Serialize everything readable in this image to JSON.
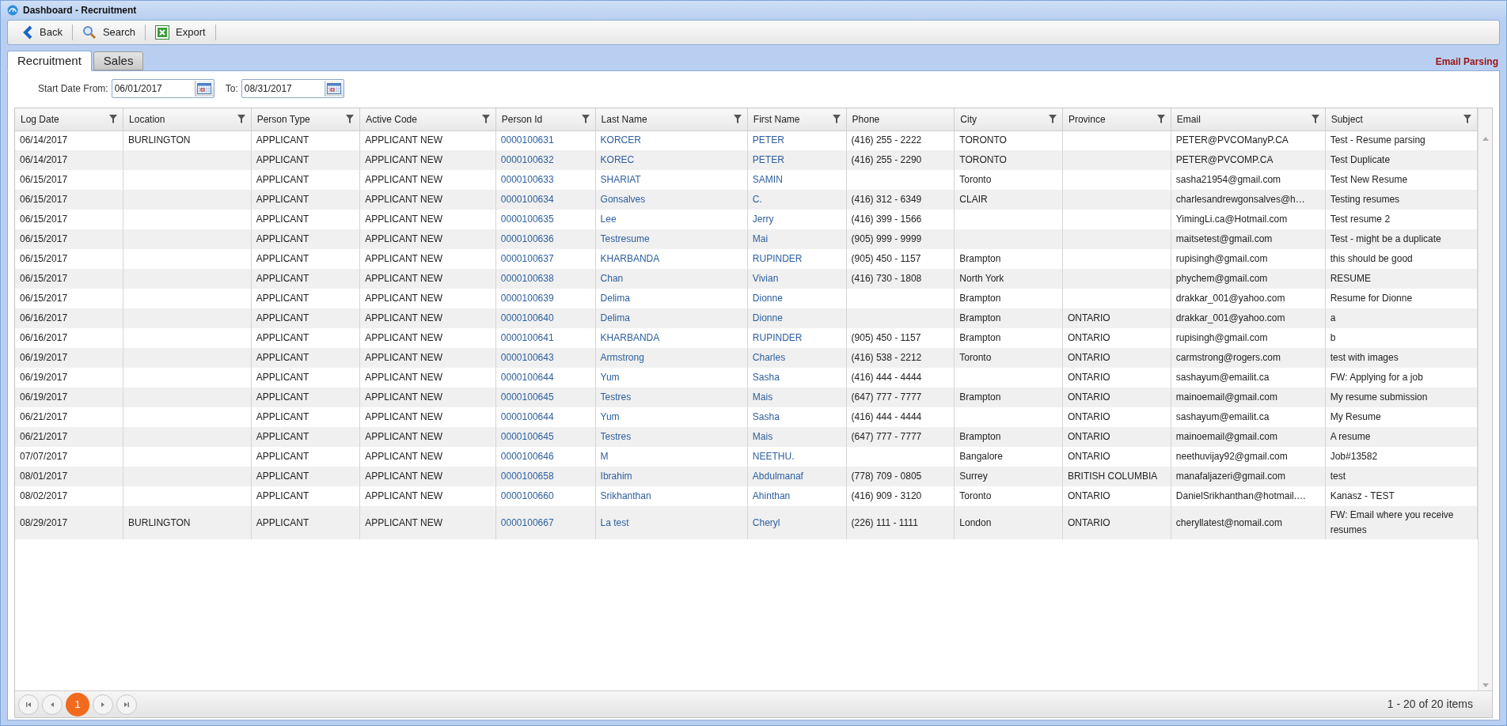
{
  "window": {
    "title": "Dashboard - Recruitment"
  },
  "toolbar": [
    {
      "kind": "back",
      "label": "Back"
    },
    {
      "kind": "search",
      "label": "Search"
    },
    {
      "kind": "export",
      "label": "Export"
    }
  ],
  "tabs": [
    {
      "label": "Recruitment",
      "selected": true
    },
    {
      "label": "Sales",
      "selected": false
    }
  ],
  "section_title": "Email Parsing",
  "filters": [
    {
      "label": "Start Date From:",
      "value": "06/01/2017"
    },
    {
      "label": "To:",
      "value": "08/31/2017"
    }
  ],
  "table": {
    "columns": [
      {
        "label": "Log Date",
        "filter": true,
        "kind": "text"
      },
      {
        "label": "Location",
        "filter": true,
        "kind": "text"
      },
      {
        "label": "Person Type",
        "filter": true,
        "kind": "text"
      },
      {
        "label": "Active Code",
        "filter": true,
        "kind": "text"
      },
      {
        "label": "Person Id",
        "filter": true,
        "kind": "link"
      },
      {
        "label": "Last Name",
        "filter": true,
        "kind": "link"
      },
      {
        "label": "First Name",
        "filter": true,
        "kind": "link"
      },
      {
        "label": "Phone",
        "filter": false,
        "kind": "text"
      },
      {
        "label": "City",
        "filter": true,
        "kind": "text"
      },
      {
        "label": "Province",
        "filter": true,
        "kind": "text"
      },
      {
        "label": "Email",
        "filter": true,
        "kind": "text"
      },
      {
        "label": "Subject",
        "filter": true,
        "kind": "text"
      }
    ],
    "rows": [
      [
        "06/14/2017",
        "BURLINGTON",
        "APPLICANT",
        "APPLICANT NEW",
        "0000100631",
        "KORCER",
        "PETER",
        "(416) 255 - 2222",
        "TORONTO",
        "",
        "PETER@PVCOManyP.CA",
        "Test - Resume parsing"
      ],
      [
        "06/14/2017",
        "",
        "APPLICANT",
        "APPLICANT NEW",
        "0000100632",
        "KOREC",
        "PETER",
        "(416) 255 - 2290",
        "TORONTO",
        "",
        "PETER@PVCOMP.CA",
        "Test Duplicate"
      ],
      [
        "06/15/2017",
        "",
        "APPLICANT",
        "APPLICANT NEW",
        "0000100633",
        "SHARIAT",
        "SAMIN",
        "",
        "Toronto",
        "",
        "sasha21954@gmail.com",
        "Test New Resume"
      ],
      [
        "06/15/2017",
        "",
        "APPLICANT",
        "APPLICANT NEW",
        "0000100634",
        "Gonsalves",
        "C.",
        "(416) 312 - 6349",
        "CLAIR",
        "",
        "charlesandrewgonsalves@h…",
        "Testing resumes"
      ],
      [
        "06/15/2017",
        "",
        "APPLICANT",
        "APPLICANT NEW",
        "0000100635",
        "Lee",
        "Jerry",
        "(416) 399 - 1566",
        "",
        "",
        "YimingLi.ca@Hotmail.com",
        "Test resume 2"
      ],
      [
        "06/15/2017",
        "",
        "APPLICANT",
        "APPLICANT NEW",
        "0000100636",
        "Testresume",
        "Mai",
        "(905) 999 - 9999",
        "",
        "",
        "maitsetest@gmail.com",
        "Test - might be a duplicate"
      ],
      [
        "06/15/2017",
        "",
        "APPLICANT",
        "APPLICANT NEW",
        "0000100637",
        "KHARBANDA",
        "RUPINDER",
        "(905) 450 - 1157",
        "Brampton",
        "",
        "rupisingh@gmail.com",
        "this should be good"
      ],
      [
        "06/15/2017",
        "",
        "APPLICANT",
        "APPLICANT NEW",
        "0000100638",
        "Chan",
        "Vivian",
        "(416) 730 - 1808",
        "North York",
        "",
        "phychem@gmail.com",
        "RESUME"
      ],
      [
        "06/15/2017",
        "",
        "APPLICANT",
        "APPLICANT NEW",
        "0000100639",
        "Delima",
        "Dionne",
        "",
        "Brampton",
        "",
        "drakkar_001@yahoo.com",
        "Resume for Dionne"
      ],
      [
        "06/16/2017",
        "",
        "APPLICANT",
        "APPLICANT NEW",
        "0000100640",
        "Delima",
        "Dionne",
        "",
        "Brampton",
        "ONTARIO",
        "drakkar_001@yahoo.com",
        "a"
      ],
      [
        "06/16/2017",
        "",
        "APPLICANT",
        "APPLICANT NEW",
        "0000100641",
        "KHARBANDA",
        "RUPINDER",
        "(905) 450 - 1157",
        "Brampton",
        "ONTARIO",
        "rupisingh@gmail.com",
        "b"
      ],
      [
        "06/19/2017",
        "",
        "APPLICANT",
        "APPLICANT NEW",
        "0000100643",
        "Armstrong",
        "Charles",
        "(416) 538 - 2212",
        "Toronto",
        "ONTARIO",
        "carmstrong@rogers.com",
        "test with images"
      ],
      [
        "06/19/2017",
        "",
        "APPLICANT",
        "APPLICANT NEW",
        "0000100644",
        "Yum",
        "Sasha",
        "(416) 444 - 4444",
        "",
        "ONTARIO",
        "sashayum@emailit.ca",
        "FW: Applying for a job"
      ],
      [
        "06/19/2017",
        "",
        "APPLICANT",
        "APPLICANT NEW",
        "0000100645",
        "Testres",
        "Mais",
        "(647) 777 - 7777",
        "Brampton",
        "ONTARIO",
        "mainoemail@gmail.com",
        "My resume submission"
      ],
      [
        "06/21/2017",
        "",
        "APPLICANT",
        "APPLICANT NEW",
        "0000100644",
        "Yum",
        "Sasha",
        "(416) 444 - 4444",
        "",
        "ONTARIO",
        "sashayum@emailit.ca",
        "My Resume"
      ],
      [
        "06/21/2017",
        "",
        "APPLICANT",
        "APPLICANT NEW",
        "0000100645",
        "Testres",
        "Mais",
        "(647) 777 - 7777",
        "Brampton",
        "ONTARIO",
        "mainoemail@gmail.com",
        "A resume"
      ],
      [
        "07/07/2017",
        "",
        "APPLICANT",
        "APPLICANT NEW",
        "0000100646",
        "M",
        "NEETHU.",
        "",
        "Bangalore",
        "ONTARIO",
        "neethuvijay92@gmail.com",
        "Job#13582"
      ],
      [
        "08/01/2017",
        "",
        "APPLICANT",
        "APPLICANT NEW",
        "0000100658",
        "Ibrahim",
        "Abdulmanaf",
        "(778) 709 - 0805",
        "Surrey",
        "BRITISH COLUMBIA",
        "manafaljazeri@gmail.com",
        "test"
      ],
      [
        "08/02/2017",
        "",
        "APPLICANT",
        "APPLICANT NEW",
        "0000100660",
        "Srikhanthan",
        "Ahinthan",
        "(416) 909 - 3120",
        "Toronto",
        "ONTARIO",
        "DanielSrikhanthan@hotmail.…",
        "Kanasz - TEST"
      ],
      [
        "08/29/2017",
        "BURLINGTON",
        "APPLICANT",
        "APPLICANT NEW",
        "0000100667",
        "La test",
        "Cheryl",
        "(226) 111 - 1111",
        "London",
        "ONTARIO",
        "cheryllatest@nomail.com",
        "FW: Email where you receive resumes"
      ]
    ]
  },
  "pager": {
    "pages": [
      {
        "label": "1",
        "selected": true
      }
    ],
    "summary": "1 - 20 of 20 items"
  }
}
